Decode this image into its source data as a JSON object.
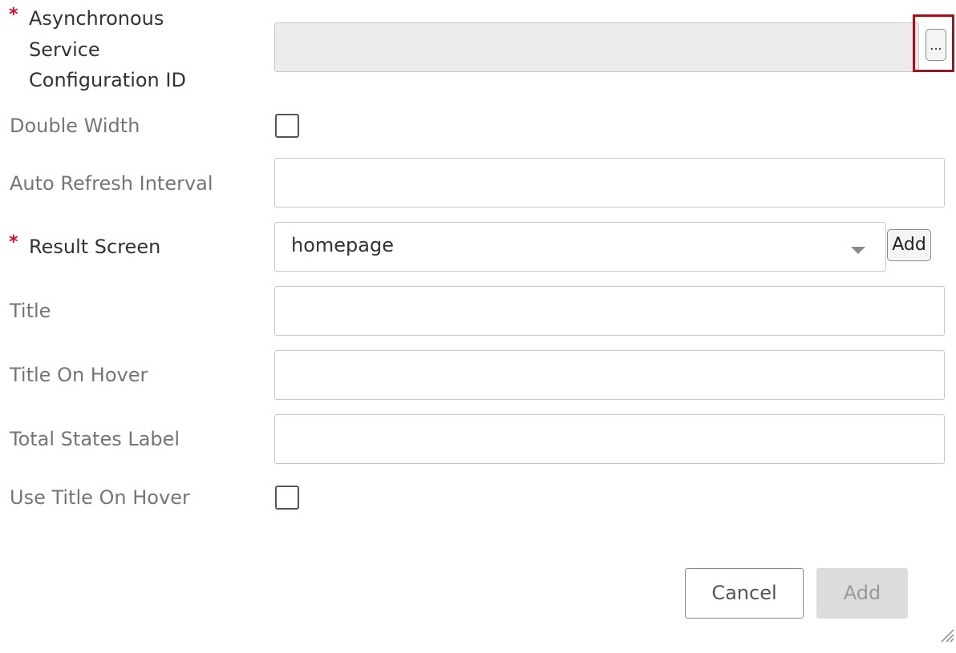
{
  "fields": {
    "async_service_config": {
      "required": "*",
      "label_lines": [
        "Asynchronous",
        "Service",
        "Configuration ID"
      ],
      "value": "",
      "lookup_label": "..."
    },
    "double_width": {
      "label": "Double Width",
      "checked": false
    },
    "auto_refresh_interval": {
      "label": "Auto Refresh Interval",
      "value": ""
    },
    "result_screen": {
      "required": "*",
      "label": "Result Screen",
      "selected": "homepage",
      "add_label": "Add"
    },
    "title": {
      "label": "Title",
      "value": ""
    },
    "title_on_hover": {
      "label": "Title On Hover",
      "value": ""
    },
    "total_states_label": {
      "label": "Total States Label",
      "value": ""
    },
    "use_title_on_hover": {
      "label": "Use Title On Hover",
      "checked": false
    }
  },
  "footer": {
    "cancel_label": "Cancel",
    "add_label": "Add"
  },
  "colors": {
    "required": "#c8102e",
    "highlight": "#a0141e",
    "disabled_bg": "#ececec",
    "border": "#c8c8c8"
  },
  "icons": {
    "dropdown": "chevron-down-icon",
    "resize": "resize-grip-icon"
  }
}
